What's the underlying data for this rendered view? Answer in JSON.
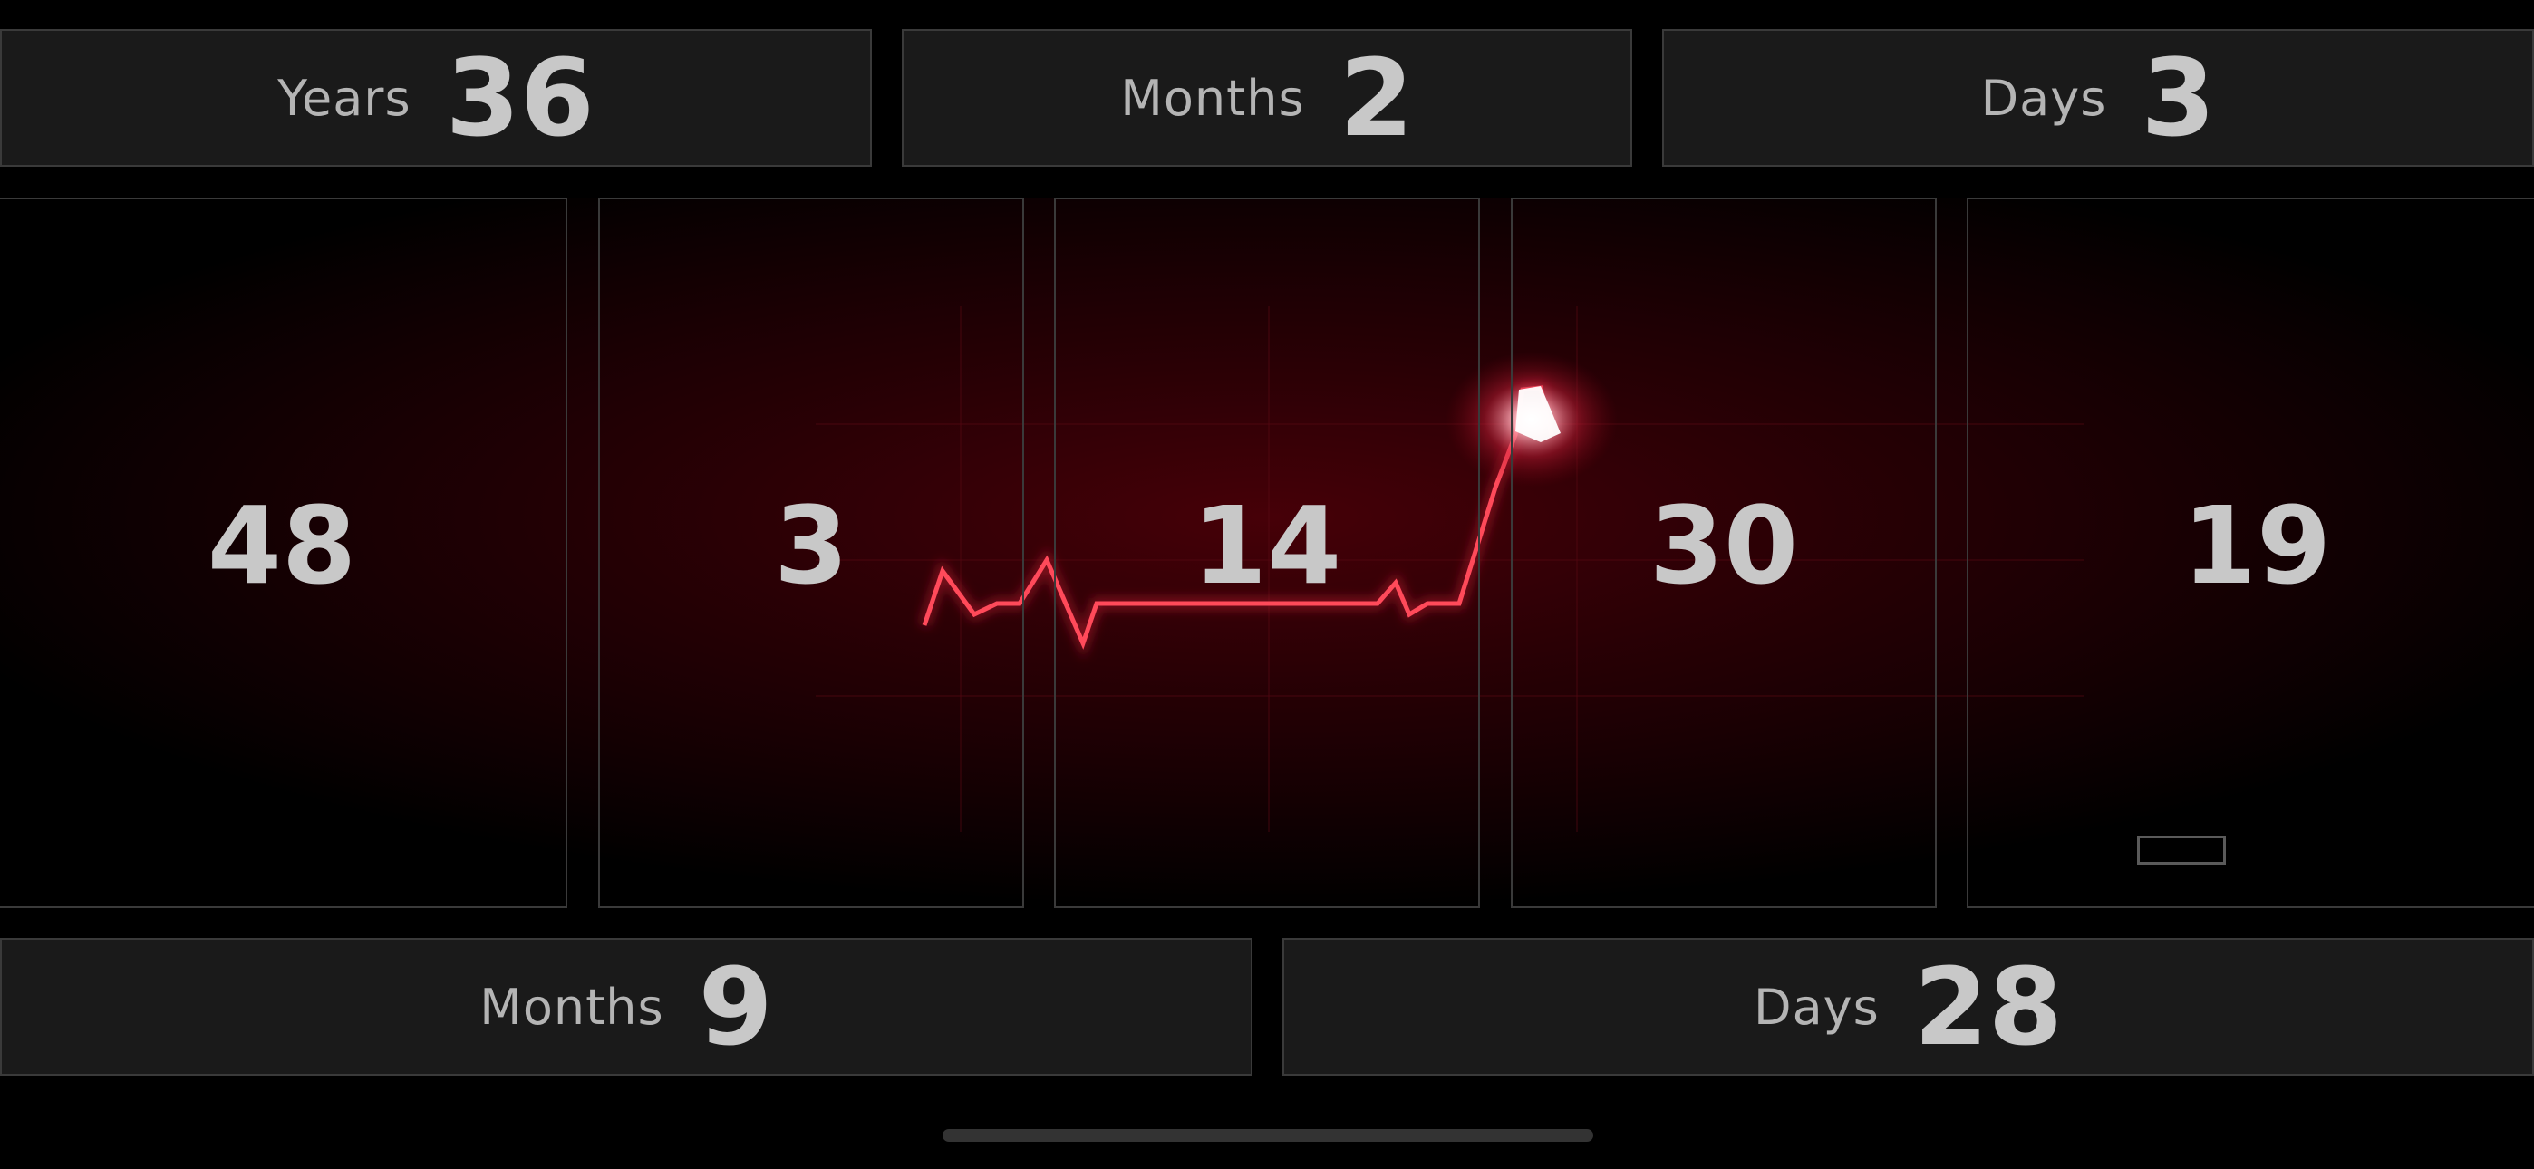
{
  "top_row": [
    {
      "label": "Years",
      "value": "36"
    },
    {
      "label": "Months",
      "value": "2"
    },
    {
      "label": "Days",
      "value": "3"
    }
  ],
  "center_tiles": [
    "48",
    "3",
    "14",
    "30",
    "19"
  ],
  "bottom_row": [
    {
      "label": "Months",
      "value": "9"
    },
    {
      "label": "Days",
      "value": "28"
    }
  ],
  "colors": {
    "background": "#000000",
    "box": "#1a1a1a",
    "border": "#3a3a3a",
    "text": "#c8c8c8",
    "ecg_line": "#e0283c"
  },
  "icons": {
    "ecg": "heartbeat-ecg-icon"
  }
}
